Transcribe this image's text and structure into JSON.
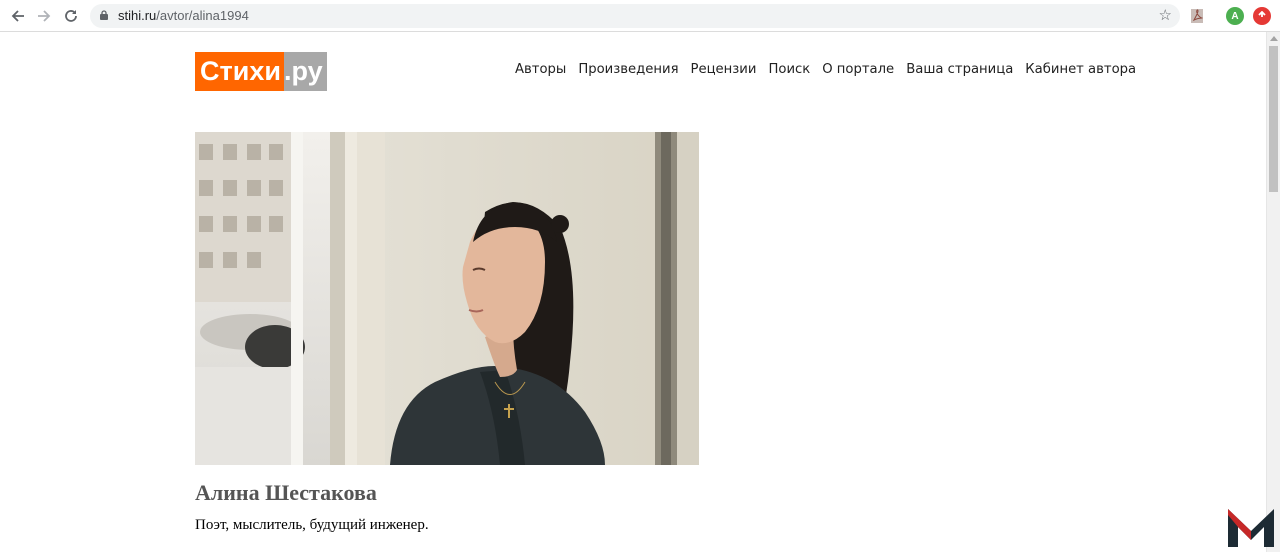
{
  "browser": {
    "url_host": "stihi.ru",
    "url_path": "/avtor/alina1994",
    "profile_initial": "A",
    "icons": [
      "back-icon",
      "forward-icon",
      "reload-icon",
      "lock-icon",
      "star-icon",
      "pdf-extension-icon",
      "profile-avatar",
      "adblock-extension-icon"
    ]
  },
  "site": {
    "logo_main": "Стихи",
    "logo_suffix": ".ру",
    "nav": [
      "Авторы",
      "Произведения",
      "Рецензии",
      "Поиск",
      "О портале",
      "Ваша страница",
      "Кабинет автора"
    ]
  },
  "author": {
    "name": "Алина Шестакова",
    "bio": "Поэт, мыслитель, будущий инженер."
  },
  "colors": {
    "logo_orange": "#ff6600",
    "logo_gray": "#a8a8a8",
    "name_color": "#555555"
  }
}
